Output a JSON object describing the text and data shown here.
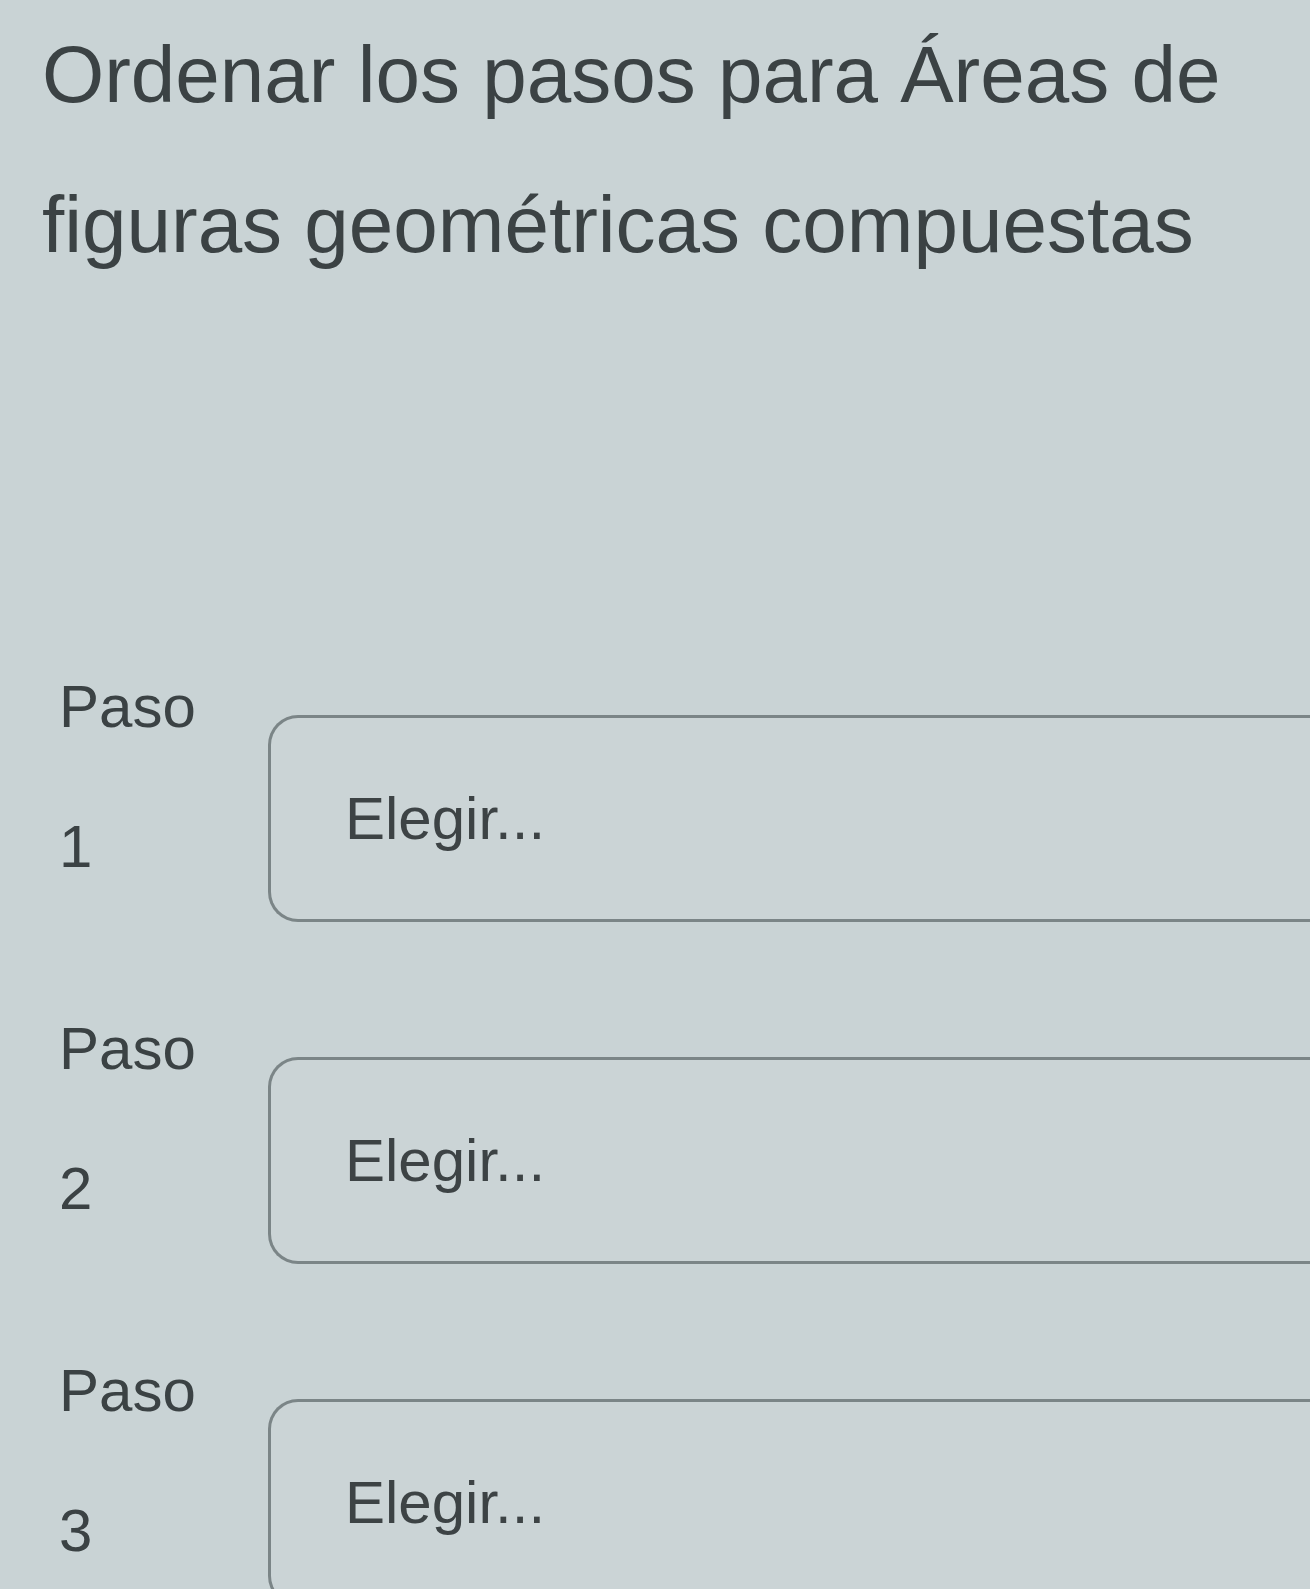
{
  "title": "Ordenar los pasos para Áreas de figuras geométricas compuestas",
  "steps": [
    {
      "label": "Paso 1",
      "dropdown": {
        "placeholder": "Elegir..."
      }
    },
    {
      "label": "Paso 2",
      "dropdown": {
        "placeholder": "Elegir..."
      }
    },
    {
      "label": "Paso 3",
      "dropdown": {
        "placeholder": "Elegir..."
      }
    }
  ]
}
